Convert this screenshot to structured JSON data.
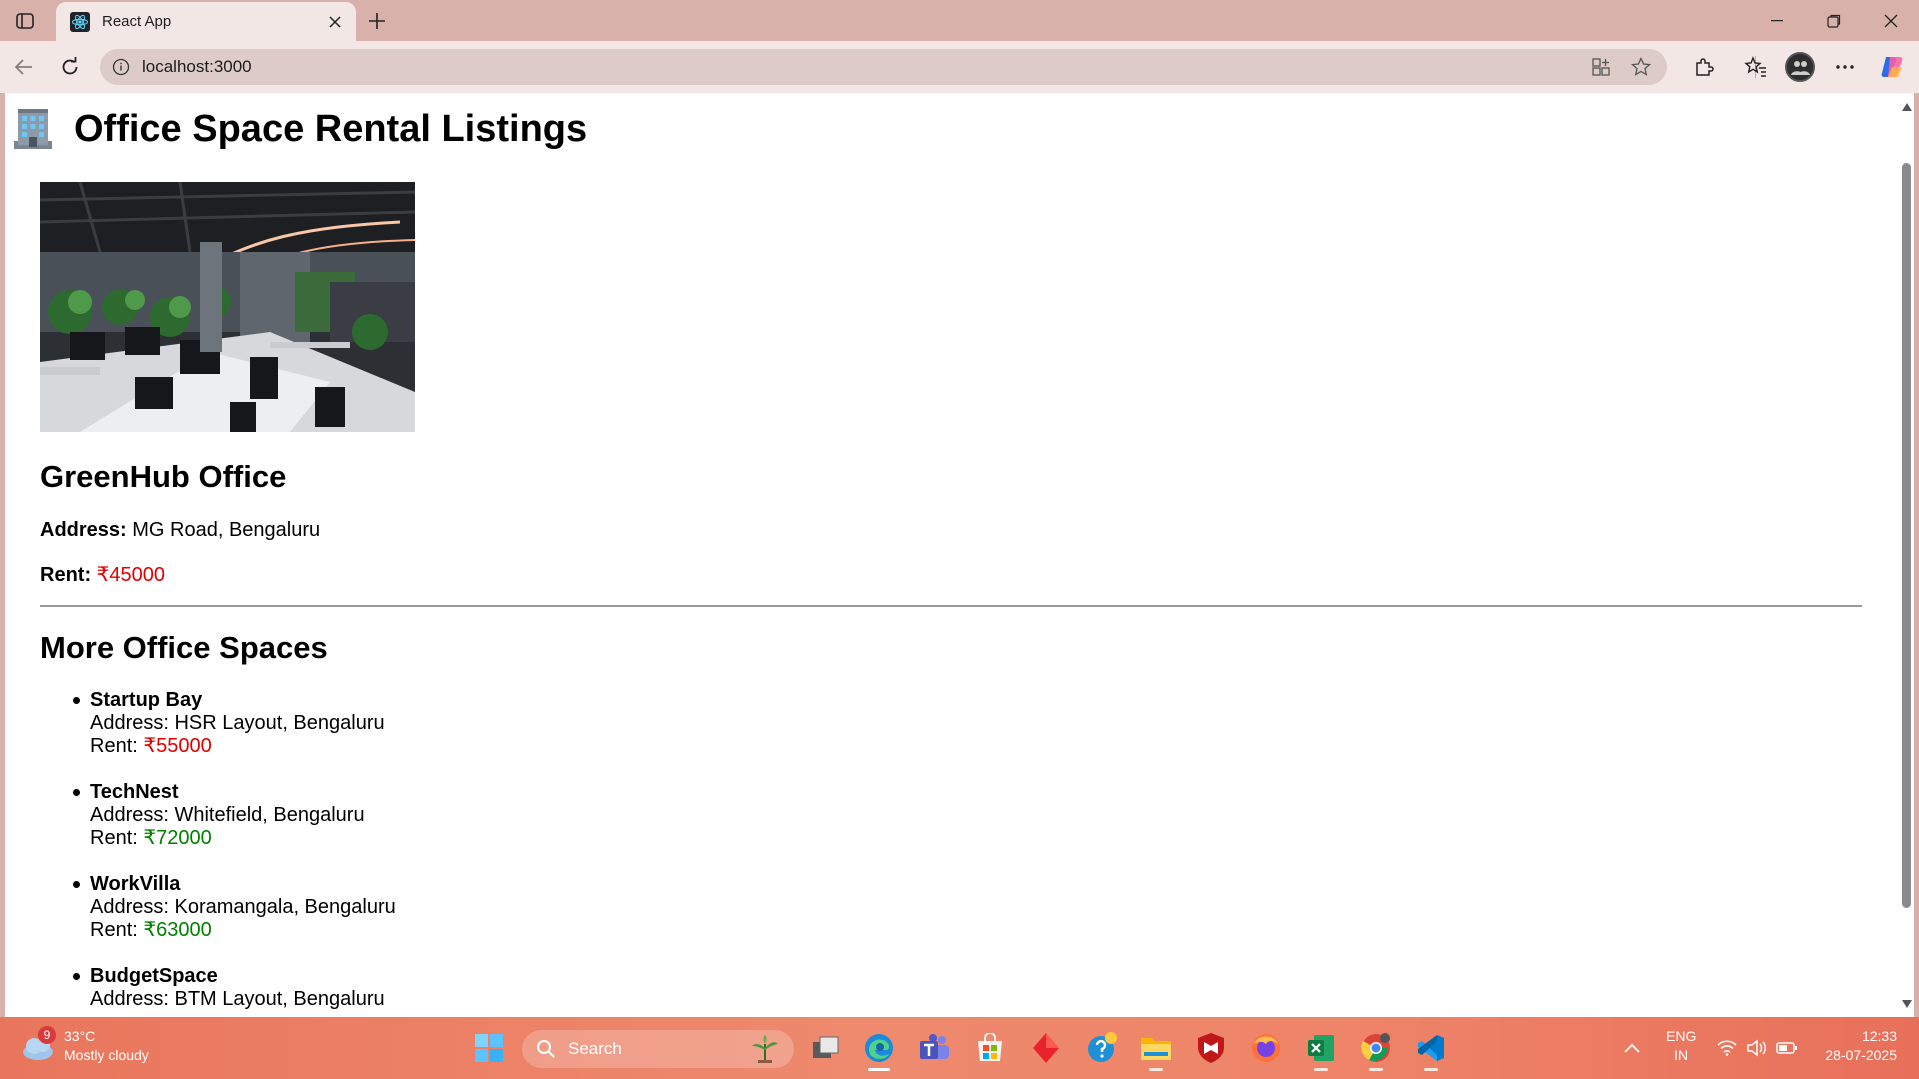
{
  "browser": {
    "tab_title": "React App",
    "url": "localhost:3000"
  },
  "page": {
    "title": "Office Space Rental Listings",
    "title_emoji": "office-building",
    "featured": {
      "name": "GreenHub Office",
      "address_label": "Address:",
      "address": "MG Road, Bengaluru",
      "rent_label": "Rent:",
      "rent": "₹45000",
      "rent_color": "#e00000"
    },
    "more_title": "More Office Spaces",
    "listings": [
      {
        "name": "Startup Bay",
        "address": "Address: HSR Layout, Bengaluru",
        "rent_label": "Rent: ",
        "rent": "₹55000",
        "rent_color": "#e00000"
      },
      {
        "name": "TechNest",
        "address": "Address: Whitefield, Bengaluru",
        "rent_label": "Rent: ",
        "rent": "₹72000",
        "rent_color": "#008000"
      },
      {
        "name": "WorkVilla",
        "address": "Address: Koramangala, Bengaluru",
        "rent_label": "Rent: ",
        "rent": "₹63000",
        "rent_color": "#008000"
      },
      {
        "name": "BudgetSpace",
        "address": "Address: BTM Layout, Bengaluru",
        "rent_label": "",
        "rent": "",
        "rent_color": "#e00000"
      }
    ]
  },
  "taskbar": {
    "weather_badge": "9",
    "temperature": "33°C",
    "condition": "Mostly cloudy",
    "search_label": "Search",
    "language_line1": "ENG",
    "language_line2": "IN",
    "time": "12:33",
    "date": "28-07-2025"
  }
}
